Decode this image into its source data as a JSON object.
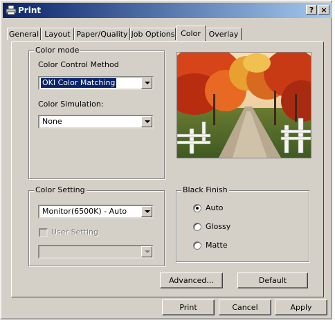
{
  "window": {
    "title": "Print",
    "help_label": "?",
    "close_label": "×"
  },
  "tabs": [
    {
      "label": "General"
    },
    {
      "label": "Layout"
    },
    {
      "label": "Paper/Quality"
    },
    {
      "label": "Job Options"
    },
    {
      "label": "Color",
      "active": true
    },
    {
      "label": "Overlay"
    }
  ],
  "color_mode": {
    "group_label": "Color mode",
    "method_label": "Color Control Method",
    "method_value": "OKI Color Matching",
    "simulation_label": "Color Simulation:",
    "simulation_value": "None"
  },
  "color_setting": {
    "group_label": "Color Setting",
    "value": "Monitor(6500K) - Auto",
    "user_setting_label": "User Setting",
    "user_setting_value": ""
  },
  "black_finish": {
    "group_label": "Black Finish",
    "options": [
      {
        "label": "Auto",
        "selected": true
      },
      {
        "label": "Glossy",
        "selected": false
      },
      {
        "label": "Matte",
        "selected": false
      }
    ]
  },
  "page_buttons": {
    "advanced": "Advanced...",
    "default": "Default"
  },
  "dialog_buttons": {
    "print": "Print",
    "cancel": "Cancel",
    "apply": "Apply"
  },
  "preview": {
    "icon": "autumn-road-photo"
  }
}
